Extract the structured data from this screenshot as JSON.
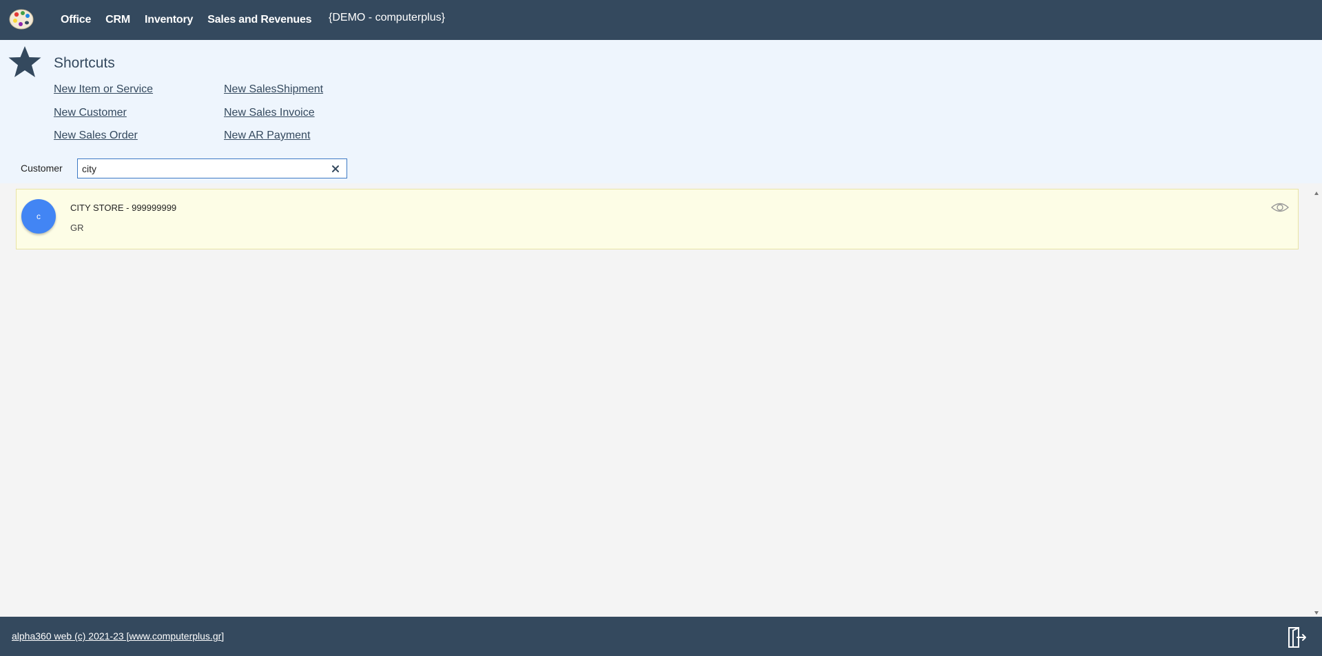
{
  "header": {
    "nav": [
      "Office",
      "CRM",
      "Inventory",
      "Sales and Revenues"
    ],
    "company": "{DEMO - computerplus}",
    "logo_icon": "palette-icon"
  },
  "shortcuts": {
    "title": "Shortcuts",
    "icon": "star-icon",
    "links": [
      "New Item or Service",
      "New Customer",
      "New Sales Order",
      "New SalesShipment",
      "New Sales Invoice",
      "New AR Payment"
    ]
  },
  "search": {
    "label": "Customer",
    "value": "city",
    "clear_icon": "close-icon"
  },
  "results": [
    {
      "avatar": "c",
      "name": "CITY STORE - 999999999",
      "country": "GR",
      "action_icon": "eye-icon"
    }
  ],
  "footer": {
    "link": "alpha360 web (c) 2021-23 [www.computerplus.gr]",
    "logout_icon": "logout-icon"
  },
  "colors": {
    "topbar": "#34495e",
    "shortcuts_bg": "#eef5fd",
    "card_bg": "#fdfde6",
    "avatar": "#4285f4",
    "accent": "#3b78c4"
  }
}
